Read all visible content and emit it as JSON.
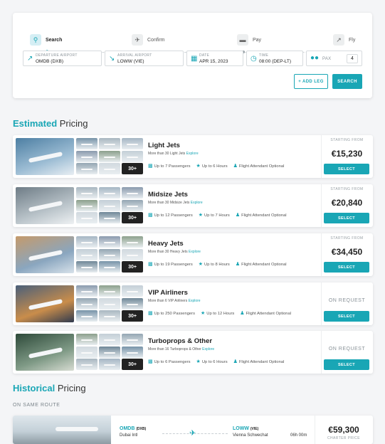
{
  "steps": [
    {
      "label": "Search",
      "icon": "search-icon"
    },
    {
      "label": "Confirm",
      "icon": "plane-icon"
    },
    {
      "label": "Pay",
      "icon": "card-icon"
    },
    {
      "label": "Fly",
      "icon": "takeoff-icon"
    }
  ],
  "fields": {
    "departure": {
      "label": "DEPARTURE AIRPORT",
      "value": "OMDB (DXB)"
    },
    "arrival": {
      "label": "ARRIVAL AIRPORT",
      "value": "LOWW (VIE)"
    },
    "date": {
      "label": "DATE",
      "value": "APR 15, 2023"
    },
    "time": {
      "label": "TIME",
      "value": "08:00 (DEP-LT)"
    },
    "pax": {
      "label": "PAX",
      "value": "4"
    }
  },
  "buttons": {
    "add_leg": "+ ADD LEG",
    "search": "SEARCH"
  },
  "estimated": {
    "accent": "Estimated",
    "rest": " Pricing"
  },
  "categories": [
    {
      "title": "Light Jets",
      "subtitle": "More than 30 Light Jets",
      "explore": "Explore",
      "pax": "Up to 7 Passengers",
      "hours": "Up to 6 Hours",
      "attendant": "Flight Attendant Optional",
      "price_label": "STARTING FROM",
      "price": "€15,230",
      "select": "SELECT",
      "more": "30+"
    },
    {
      "title": "Midsize Jets",
      "subtitle": "More than 30 Midsize Jets",
      "explore": "Explore",
      "pax": "Up to 12 Passengers",
      "hours": "Up to 7 Hours",
      "attendant": "Flight Attendant Optional",
      "price_label": "STARTING FROM",
      "price": "€20,840",
      "select": "SELECT",
      "more": "30+"
    },
    {
      "title": "Heavy Jets",
      "subtitle": "More than 30 Heavy Jets",
      "explore": "Explore",
      "pax": "Up to 19 Passengers",
      "hours": "Up to 8 Hours",
      "attendant": "Flight Attendant Optional",
      "price_label": "STARTING FROM",
      "price": "€34,450",
      "select": "SELECT",
      "more": "30+"
    },
    {
      "title": "VIP Airliners",
      "subtitle": "More than 6 VIP Airliners",
      "explore": "Explore",
      "pax": "Up to 250 Passengers",
      "hours": "Up to 12 Hours",
      "attendant": "Flight Attendant Optional",
      "request": "ON REQUEST",
      "select": "SELECT",
      "more": "30+"
    },
    {
      "title": "Turboprops & Other",
      "subtitle": "More than 16 Turboprops & Other",
      "explore": "Explore",
      "pax": "Up to 6 Passengers",
      "hours": "Up to 6 Hours",
      "attendant": "Flight Attendant Optional",
      "request": "ON REQUEST",
      "select": "SELECT",
      "more": "30+"
    }
  ],
  "historical": {
    "accent": "Historical",
    "rest": " Pricing",
    "subheading": "ON SAME ROUTE"
  },
  "route": {
    "from_code": "OMDB",
    "from_iata": "(DXB)",
    "from_name": "Dubai Intl",
    "to_code": "LOWW",
    "to_iata": "(VIE)",
    "to_name": "Vienna Schwechat",
    "duration": "06h 00m",
    "price": "€59,300",
    "price_label": "CHARTER PRICE"
  },
  "colors": {
    "accent": "#19a6b5"
  }
}
